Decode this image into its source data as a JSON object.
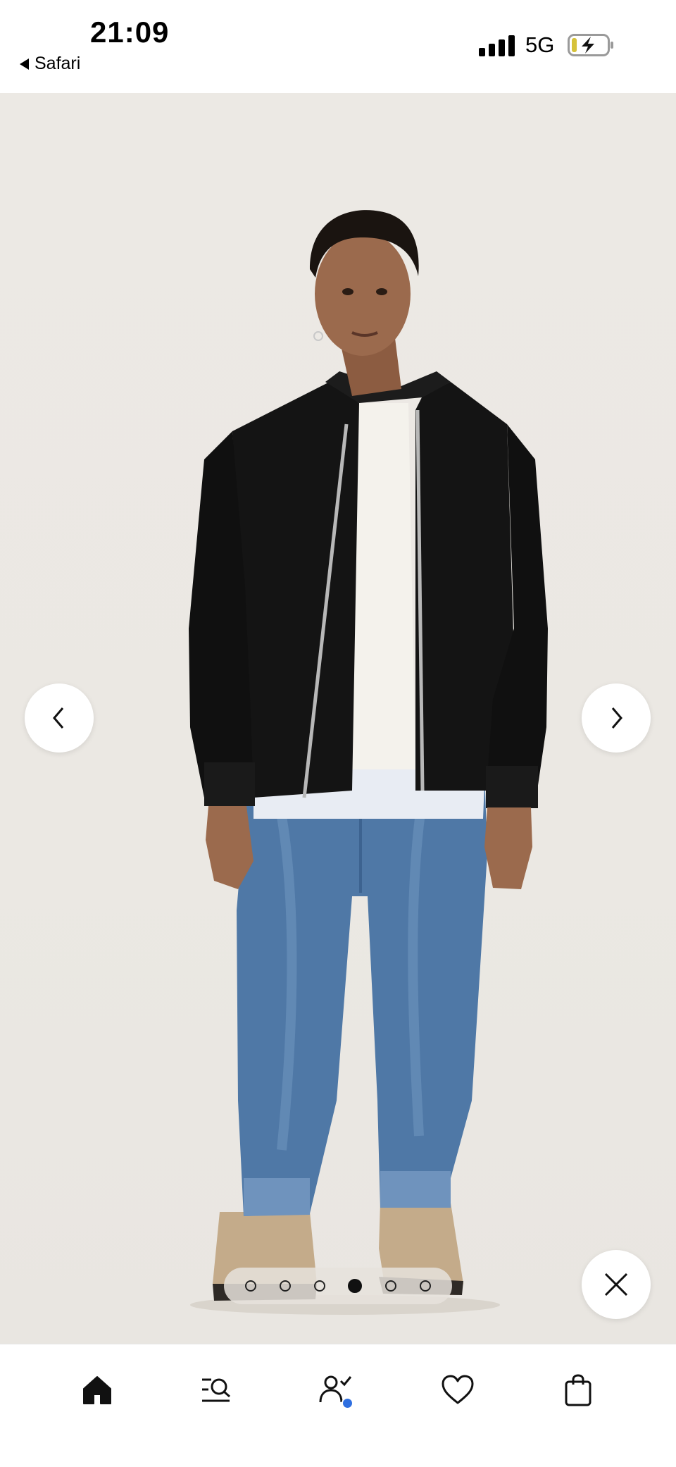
{
  "status_bar": {
    "time": "21:09",
    "back_app": "Safari",
    "network": "5G",
    "battery_level": 0.15,
    "battery_charging": true,
    "signal_bars": 4
  },
  "gallery": {
    "image_count": 6,
    "active_index": 3,
    "prev_icon": "chevron-left-icon",
    "next_icon": "chevron-right-icon",
    "close_icon": "close-icon"
  },
  "tab_bar": {
    "items": [
      {
        "icon": "home-icon",
        "active": true
      },
      {
        "icon": "search-icon",
        "active": false
      },
      {
        "icon": "account-icon",
        "active": false,
        "badge": true
      },
      {
        "icon": "heart-icon",
        "active": false
      },
      {
        "icon": "shopping-bag-icon",
        "active": false
      }
    ]
  },
  "colors": {
    "background": "#ebe8e3",
    "jacket": "#141414",
    "denim": "#4f78a6",
    "boots": "#c4ab8a",
    "badge": "#2f6fe0"
  }
}
